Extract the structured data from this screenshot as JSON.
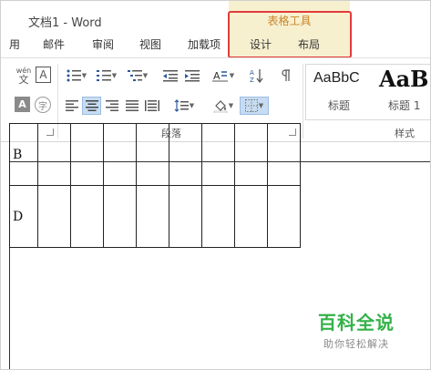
{
  "window": {
    "title": "文档1 - Word"
  },
  "context_tab": {
    "title": "表格工具",
    "tabs": [
      "设计",
      "布局"
    ]
  },
  "ribbon_tabs": [
    "用",
    "邮件",
    "审阅",
    "视图",
    "加载项"
  ],
  "ribbon": {
    "font_group": {
      "phonetic_top": "wén",
      "phonetic_bottom": "文",
      "border_char": "A",
      "shade_char": "A",
      "enclose_char": "字"
    },
    "paragraph_group": {
      "label": "段落"
    },
    "styles_group": {
      "label": "样式",
      "items": [
        {
          "preview": "AaBbC",
          "name": "标题"
        },
        {
          "preview": "AaB",
          "name": "标题 1"
        }
      ]
    }
  },
  "document": {
    "table": {
      "rows": [
        [
          "B",
          "",
          "",
          "",
          "",
          "",
          "",
          "",
          ""
        ],
        [
          "D",
          "",
          "",
          "",
          "",
          "",
          "",
          "",
          ""
        ]
      ]
    }
  },
  "watermark": {
    "main": "百科全说",
    "sub": "助你轻松解决"
  },
  "colors": {
    "highlight_box": "#e23b3b",
    "context_tab_bg": "#f7f0cf",
    "context_tab_text": "#c8862a",
    "watermark": "#33b249",
    "selected_button": "#c7dcf2"
  }
}
